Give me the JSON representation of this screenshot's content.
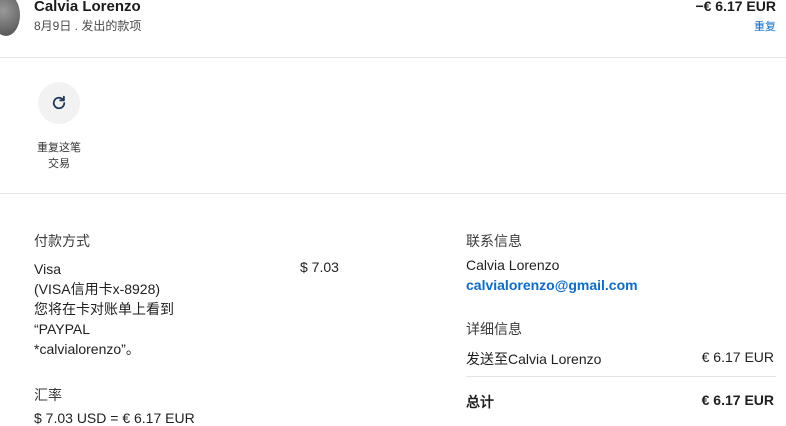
{
  "header": {
    "name": "Calvia Lorenzo",
    "subtitle": "8月9日 . 发出的款项",
    "amount": "−€ 6.17 EUR",
    "repeat_link": "重复"
  },
  "actions": {
    "repeat_label_line1": "重复这笔",
    "repeat_label_line2": "交易",
    "icon": "refresh-icon"
  },
  "payment": {
    "title": "付款方式",
    "lines": [
      "Visa",
      "(VISA信用卡x-8928)",
      "您将在卡对账单上看到",
      "“PAYPAL",
      "*calvialorenzo”。"
    ],
    "amount": "$ 7.03"
  },
  "exchange": {
    "title": "汇率",
    "text": "$ 7.03 USD = € 6.17 EUR"
  },
  "contact": {
    "title": "联系信息",
    "name": "Calvia Lorenzo",
    "email": "calvialorenzo@gmail.com"
  },
  "details": {
    "title": "详细信息",
    "sent_to_label": "发送至Calvia Lorenzo",
    "sent_to_amount": "€ 6.17 EUR",
    "total_label": "总计",
    "total_amount": "€ 6.17 EUR"
  },
  "colors": {
    "link": "#0b6ccf",
    "divider": "#e4e4e4",
    "button_bg": "#f2f2f2"
  }
}
